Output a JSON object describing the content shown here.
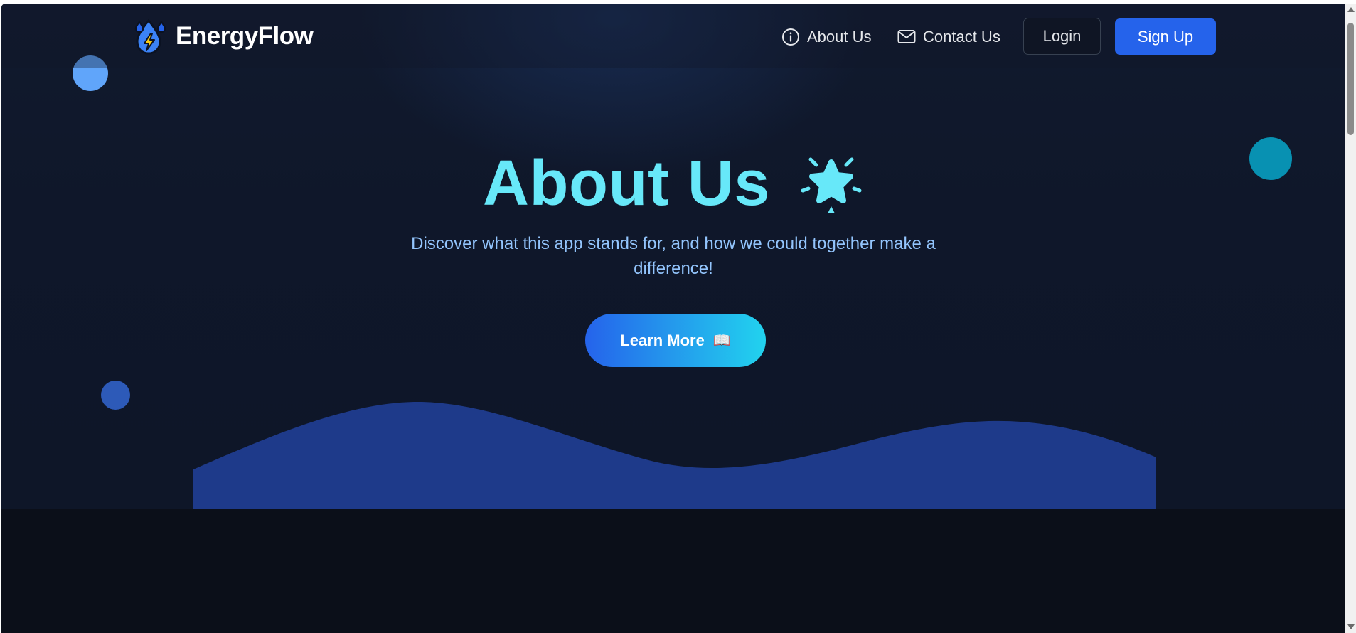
{
  "navbar": {
    "brand": {
      "name": "EnergyFlow",
      "logo_icon": "energy-drop-logo-icon"
    },
    "links": [
      {
        "label": "About Us",
        "icon": "info-icon"
      },
      {
        "label": "Contact Us",
        "icon": "mail-icon"
      }
    ],
    "login_label": "Login",
    "signup_label": "Sign Up"
  },
  "hero": {
    "title": "About Us",
    "title_icon": "sparkle-star-icon",
    "subtitle": "Discover what this app stands for, and how we could together make a difference!",
    "cta_label": "Learn More",
    "cta_icon": "📖"
  },
  "colors": {
    "accent": "#67e8f9",
    "primary": "#2563eb",
    "subtitle": "#93c5fd",
    "wave": "#1e3a8a",
    "background": "#0f172a"
  }
}
